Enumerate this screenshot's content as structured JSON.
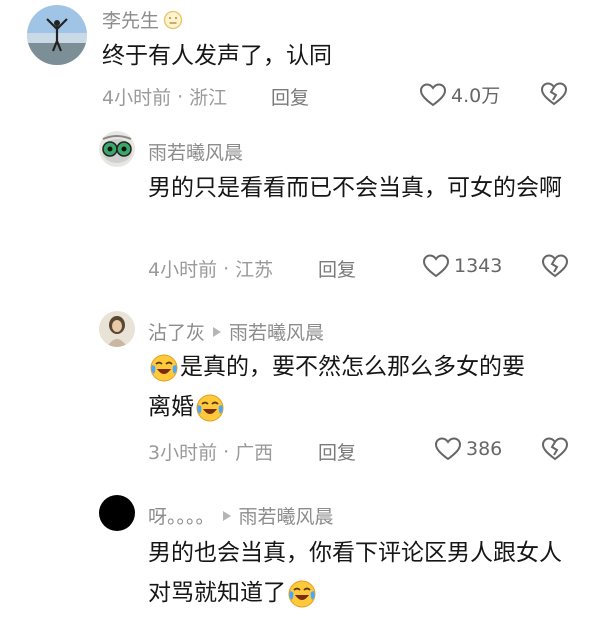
{
  "comments": [
    {
      "author": "李先生",
      "author_badge_icon": "neutral-face-icon",
      "text": "终于有人发声了，认同",
      "time": "4小时前",
      "location": "浙江",
      "reply_label": "回复",
      "likes": "4.0万"
    },
    {
      "author": "雨若曦风晨",
      "text": "男的只是看看而已不会当真，可女的会啊",
      "time": "4小时前",
      "location": "江苏",
      "reply_label": "回复",
      "likes": "1343"
    },
    {
      "author": "沾了灰",
      "reply_to": "雨若曦风晨",
      "text_part1": "是真的，要不然怎么那么多女的要",
      "text_part2": "离婚",
      "emoji_icon": "crying-laughing-face-icon",
      "time": "3小时前",
      "location": "广西",
      "reply_label": "回复",
      "likes": "386"
    },
    {
      "author": "呀。。。。",
      "reply_to": "雨若曦风晨",
      "text": "男的也会当真，你看下评论区男人跟女人对骂就知道了",
      "emoji_icon": "crying-laughing-face-icon"
    }
  ],
  "meta_separator": "·"
}
